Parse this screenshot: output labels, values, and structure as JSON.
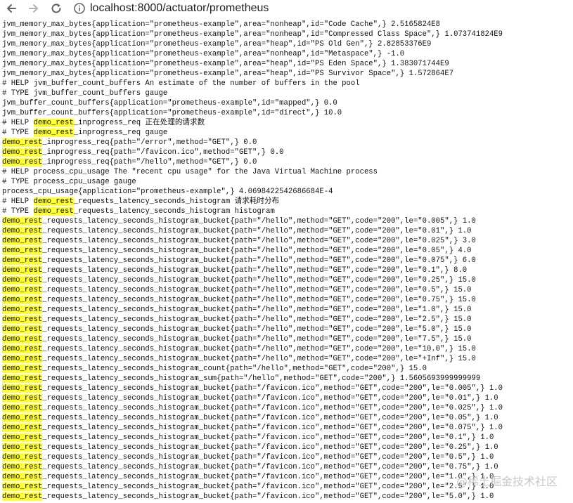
{
  "browser": {
    "url": "localhost:8000/actuator/prometheus",
    "back_icon": "arrow-left-icon",
    "forward_icon": "arrow-right-icon",
    "reload_icon": "reload-icon",
    "info_icon": "info-circle-icon"
  },
  "highlight_color": "#ffff33",
  "lines": [
    {
      "hl": "",
      "text": "jvm_memory_max_bytes{application=\"prometheus-example\",area=\"nonheap\",id=\"Code Cache\",} 2.5165824E8"
    },
    {
      "hl": "",
      "text": "jvm_memory_max_bytes{application=\"prometheus-example\",area=\"nonheap\",id=\"Compressed Class Space\",} 1.073741824E9"
    },
    {
      "hl": "",
      "text": "jvm_memory_max_bytes{application=\"prometheus-example\",area=\"heap\",id=\"PS Old Gen\",} 2.82853376E9"
    },
    {
      "hl": "",
      "text": "jvm_memory_max_bytes{application=\"prometheus-example\",area=\"nonheap\",id=\"Metaspace\",} -1.0"
    },
    {
      "hl": "",
      "text": "jvm_memory_max_bytes{application=\"prometheus-example\",area=\"heap\",id=\"PS Eden Space\",} 1.383071744E9"
    },
    {
      "hl": "",
      "text": "jvm_memory_max_bytes{application=\"prometheus-example\",area=\"heap\",id=\"PS Survivor Space\",} 1.572864E7"
    },
    {
      "hl": "",
      "text": "# HELP jvm_buffer_count_buffers An estimate of the number of buffers in the pool"
    },
    {
      "hl": "",
      "text": "# TYPE jvm_buffer_count_buffers gauge"
    },
    {
      "hl": "",
      "text": "jvm_buffer_count_buffers{application=\"prometheus-example\",id=\"mapped\",} 0.0"
    },
    {
      "hl": "",
      "text": "jvm_buffer_count_buffers{application=\"prometheus-example\",id=\"direct\",} 10.0"
    },
    {
      "pre": "# HELP ",
      "hl": "demo_rest",
      "text": "_inprogress_req 正在处理的请求数"
    },
    {
      "pre": "# TYPE ",
      "hl": "demo_rest",
      "text": "_inprogress_req gauge"
    },
    {
      "hl": "demo_rest",
      "text": "_inprogress_req{path=\"/error\",method=\"GET\",} 0.0"
    },
    {
      "hl": "demo_rest",
      "text": "_inprogress_req{path=\"/favicon.ico\",method=\"GET\",} 0.0"
    },
    {
      "hl": "demo_rest",
      "text": "_inprogress_req{path=\"/hello\",method=\"GET\",} 0.0"
    },
    {
      "hl": "",
      "text": "# HELP process_cpu_usage The \"recent cpu usage\" for the Java Virtual Machine process"
    },
    {
      "hl": "",
      "text": "# TYPE process_cpu_usage gauge"
    },
    {
      "hl": "",
      "text": "process_cpu_usage{application=\"prometheus-example\",} 4.0698422542686684E-4"
    },
    {
      "pre": "# HELP ",
      "hl": "demo_rest",
      "text": "_requests_latency_seconds_histogram 请求耗时分布"
    },
    {
      "pre": "# TYPE ",
      "hl": "demo_rest",
      "text": "_requests_latency_seconds_histogram histogram"
    },
    {
      "hl": "demo_rest",
      "text": "_requests_latency_seconds_histogram_bucket{path=\"/hello\",method=\"GET\",code=\"200\",le=\"0.005\",} 1.0"
    },
    {
      "hl": "demo_rest",
      "text": "_requests_latency_seconds_histogram_bucket{path=\"/hello\",method=\"GET\",code=\"200\",le=\"0.01\",} 1.0"
    },
    {
      "hl": "demo_rest",
      "text": "_requests_latency_seconds_histogram_bucket{path=\"/hello\",method=\"GET\",code=\"200\",le=\"0.025\",} 3.0"
    },
    {
      "hl": "demo_rest",
      "text": "_requests_latency_seconds_histogram_bucket{path=\"/hello\",method=\"GET\",code=\"200\",le=\"0.05\",} 4.0"
    },
    {
      "hl": "demo_rest",
      "text": "_requests_latency_seconds_histogram_bucket{path=\"/hello\",method=\"GET\",code=\"200\",le=\"0.075\",} 6.0"
    },
    {
      "hl": "demo_rest",
      "text": "_requests_latency_seconds_histogram_bucket{path=\"/hello\",method=\"GET\",code=\"200\",le=\"0.1\",} 8.0"
    },
    {
      "hl": "demo_rest",
      "text": "_requests_latency_seconds_histogram_bucket{path=\"/hello\",method=\"GET\",code=\"200\",le=\"0.25\",} 15.0"
    },
    {
      "hl": "demo_rest",
      "text": "_requests_latency_seconds_histogram_bucket{path=\"/hello\",method=\"GET\",code=\"200\",le=\"0.5\",} 15.0"
    },
    {
      "hl": "demo_rest",
      "text": "_requests_latency_seconds_histogram_bucket{path=\"/hello\",method=\"GET\",code=\"200\",le=\"0.75\",} 15.0"
    },
    {
      "hl": "demo_rest",
      "text": "_requests_latency_seconds_histogram_bucket{path=\"/hello\",method=\"GET\",code=\"200\",le=\"1.0\",} 15.0"
    },
    {
      "hl": "demo_rest",
      "text": "_requests_latency_seconds_histogram_bucket{path=\"/hello\",method=\"GET\",code=\"200\",le=\"2.5\",} 15.0"
    },
    {
      "hl": "demo_rest",
      "text": "_requests_latency_seconds_histogram_bucket{path=\"/hello\",method=\"GET\",code=\"200\",le=\"5.0\",} 15.0"
    },
    {
      "hl": "demo_rest",
      "text": "_requests_latency_seconds_histogram_bucket{path=\"/hello\",method=\"GET\",code=\"200\",le=\"7.5\",} 15.0"
    },
    {
      "hl": "demo_rest",
      "text": "_requests_latency_seconds_histogram_bucket{path=\"/hello\",method=\"GET\",code=\"200\",le=\"10.0\",} 15.0"
    },
    {
      "hl": "demo_rest",
      "text": "_requests_latency_seconds_histogram_bucket{path=\"/hello\",method=\"GET\",code=\"200\",le=\"+Inf\",} 15.0"
    },
    {
      "hl": "demo_rest",
      "text": "_requests_latency_seconds_histogram_count{path=\"/hello\",method=\"GET\",code=\"200\",} 15.0"
    },
    {
      "hl": "demo_rest",
      "text": "_requests_latency_seconds_histogram_sum{path=\"/hello\",method=\"GET\",code=\"200\",} 1.5605693999999999"
    },
    {
      "hl": "demo_rest",
      "text": "_requests_latency_seconds_histogram_bucket{path=\"/favicon.ico\",method=\"GET\",code=\"200\",le=\"0.005\",} 1.0"
    },
    {
      "hl": "demo_rest",
      "text": "_requests_latency_seconds_histogram_bucket{path=\"/favicon.ico\",method=\"GET\",code=\"200\",le=\"0.01\",} 1.0"
    },
    {
      "hl": "demo_rest",
      "text": "_requests_latency_seconds_histogram_bucket{path=\"/favicon.ico\",method=\"GET\",code=\"200\",le=\"0.025\",} 1.0"
    },
    {
      "hl": "demo_rest",
      "text": "_requests_latency_seconds_histogram_bucket{path=\"/favicon.ico\",method=\"GET\",code=\"200\",le=\"0.05\",} 1.0"
    },
    {
      "hl": "demo_rest",
      "text": "_requests_latency_seconds_histogram_bucket{path=\"/favicon.ico\",method=\"GET\",code=\"200\",le=\"0.075\",} 1.0"
    },
    {
      "hl": "demo_rest",
      "text": "_requests_latency_seconds_histogram_bucket{path=\"/favicon.ico\",method=\"GET\",code=\"200\",le=\"0.1\",} 1.0"
    },
    {
      "hl": "demo_rest",
      "text": "_requests_latency_seconds_histogram_bucket{path=\"/favicon.ico\",method=\"GET\",code=\"200\",le=\"0.25\",} 1.0"
    },
    {
      "hl": "demo_rest",
      "text": "_requests_latency_seconds_histogram_bucket{path=\"/favicon.ico\",method=\"GET\",code=\"200\",le=\"0.5\",} 1.0"
    },
    {
      "hl": "demo_rest",
      "text": "_requests_latency_seconds_histogram_bucket{path=\"/favicon.ico\",method=\"GET\",code=\"200\",le=\"0.75\",} 1.0"
    },
    {
      "hl": "demo_rest",
      "text": "_requests_latency_seconds_histogram_bucket{path=\"/favicon.ico\",method=\"GET\",code=\"200\",le=\"1.0\",} 1.0"
    },
    {
      "hl": "demo_rest",
      "text": "_requests_latency_seconds_histogram_bucket{path=\"/favicon.ico\",method=\"GET\",code=\"200\",le=\"2.5\",} 1.0"
    },
    {
      "hl": "demo_rest",
      "text": "_requests_latency_seconds_histogram_bucket{path=\"/favicon.ico\",method=\"GET\",code=\"200\",le=\"5.0\",} 1.0"
    }
  ],
  "watermark": "@稀土掘金技术社区"
}
